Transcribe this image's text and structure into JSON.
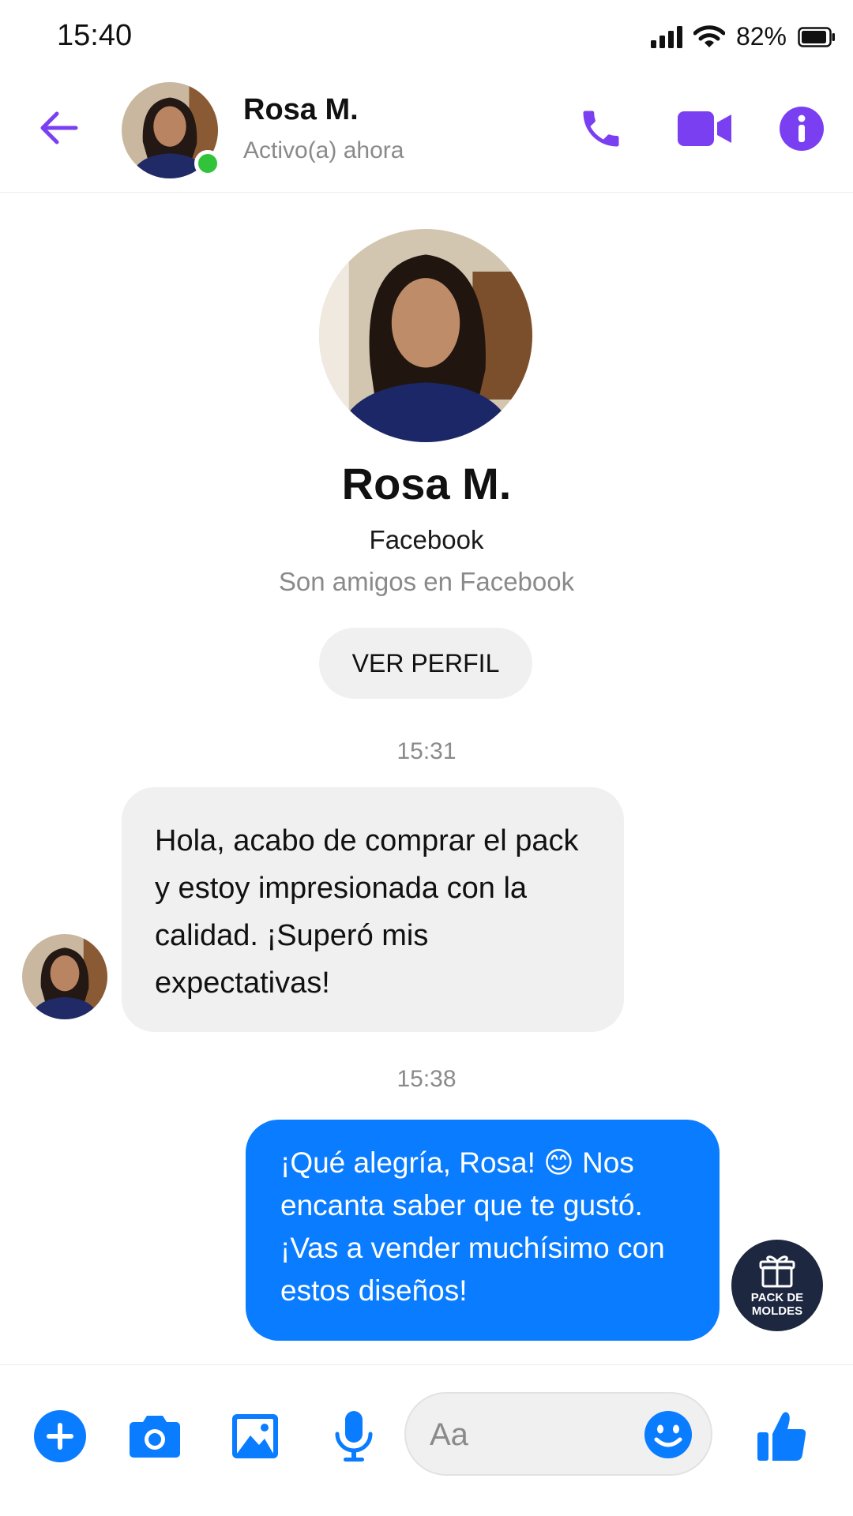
{
  "status_bar": {
    "time": "15:40",
    "battery": "82%"
  },
  "header": {
    "name": "Rosa M.",
    "status": "Activo(a) ahora"
  },
  "profile": {
    "name": "Rosa M.",
    "platform": "Facebook",
    "relationship": "Son amigos en Facebook",
    "view_profile_label": "VER PERFIL"
  },
  "messages": [
    {
      "timestamp": "15:31",
      "direction": "incoming",
      "text": "Hola, acabo de comprar el pack y estoy impresionada con la calidad. ¡Superó mis expectativas!"
    },
    {
      "timestamp": "15:38",
      "direction": "outgoing",
      "text": "¡Qué alegría, Rosa! 😊 Nos encanta saber que te gustó. ¡Vas a vender muchísimo con estos diseños!"
    }
  ],
  "badge": {
    "label": "PACK DE\nMOLDES"
  },
  "composer": {
    "placeholder": "Aa"
  },
  "colors": {
    "accent_purple": "#7b3ff2",
    "messenger_blue": "#0a7cff",
    "online_green": "#31c43b"
  }
}
